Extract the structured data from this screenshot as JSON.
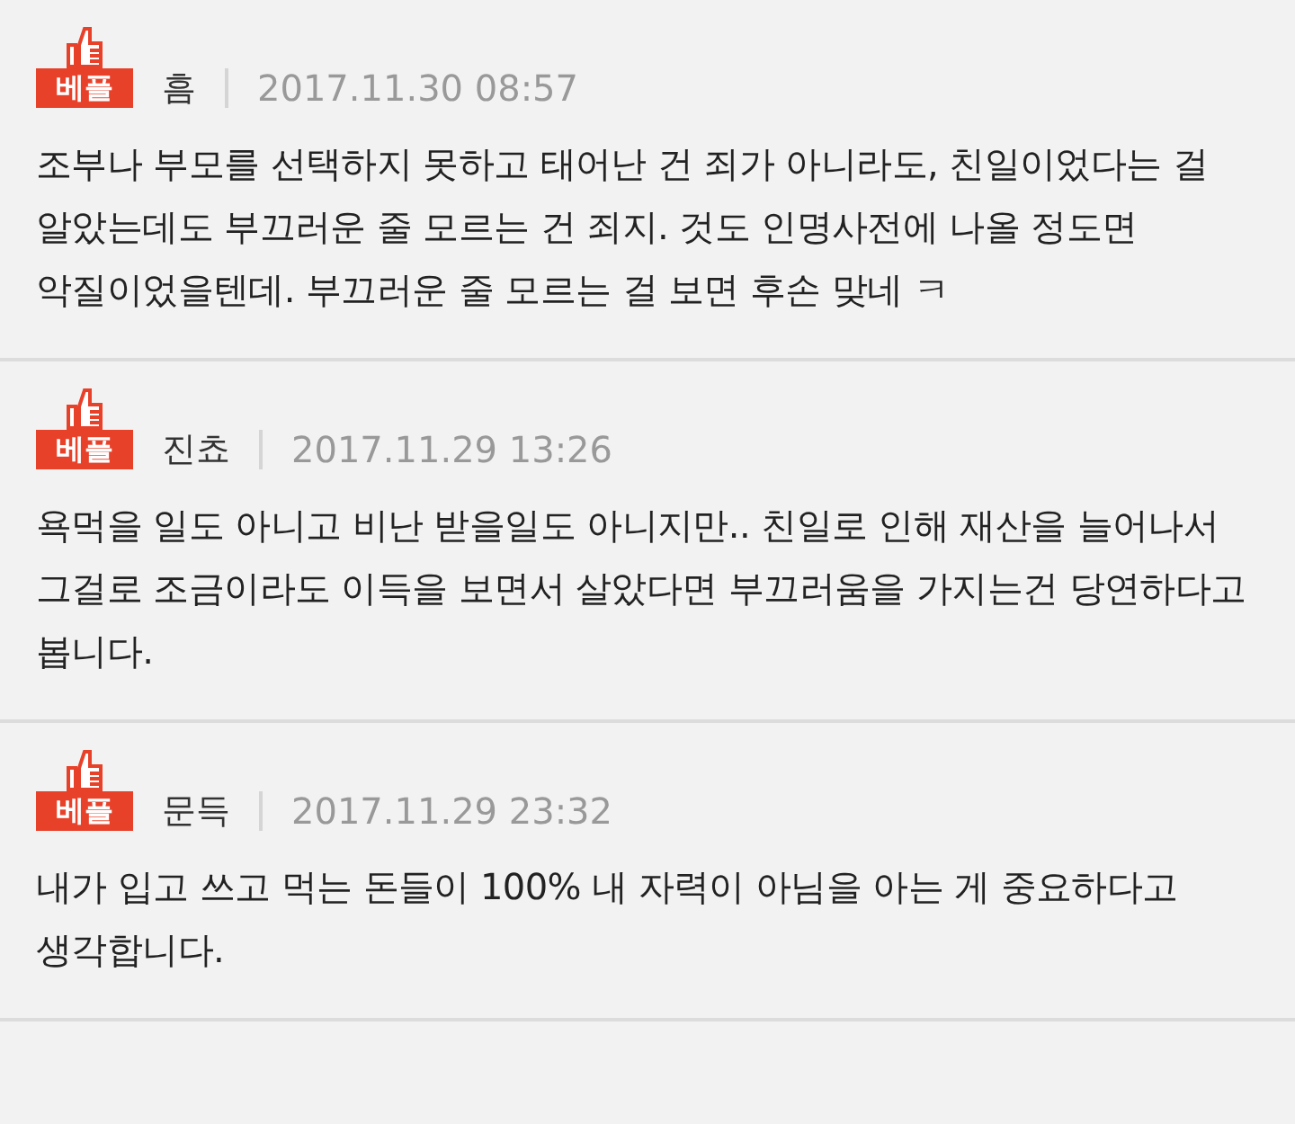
{
  "comments": [
    {
      "badge": "베플",
      "author": "흠",
      "date": "2017.11.30 08:57",
      "text": "조부나 부모를 선택하지 못하고 태어난 건 죄가 아니라도, 친일이었다는 걸 알았는데도 부끄러운 줄 모르는 건 죄지. 것도 인명사전에 나올 정도면 악질이었을텐데. 부끄러운 줄 모르는 걸 보면 후손 맞네 ㅋ"
    },
    {
      "badge": "베플",
      "author": "진쵸",
      "date": "2017.11.29 13:26",
      "text": "욕먹을 일도 아니고 비난 받을일도 아니지만.. 친일로 인해 재산을 늘어나서 그걸로 조금이라도 이득을 보면서 살았다면 부끄러움을 가지는건 당연하다고 봅니다."
    },
    {
      "badge": "베플",
      "author": "문득",
      "date": "2017.11.29 23:32",
      "text": "내가 입고 쓰고 먹는 돈들이 100% 내 자력이 아님을 아는 게 중요하다고 생각합니다."
    }
  ]
}
